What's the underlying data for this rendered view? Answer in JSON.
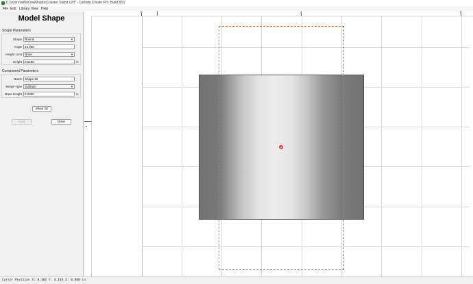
{
  "window": {
    "title": "C:\\Users\\wilfa\\Downloads\\Coaster Stand.c2d* - Carbide Create Pro: Build 653"
  },
  "menu": [
    "File",
    "Edit",
    "Library",
    "View",
    "Help"
  ],
  "panel": {
    "title": "Model Shape",
    "shape_parameters": {
      "header": "Shape Parameters",
      "shape_label": "Shape",
      "shape_value": "Round",
      "angle_label": "Angle",
      "angle_value": "45.000",
      "height_limit_label": "Height Limit",
      "height_limit_value": "None",
      "height_label": "Height",
      "height_value": "0.6250",
      "height_unit": "in"
    },
    "component_parameters": {
      "header": "Component Parameters",
      "name_label": "Name",
      "name_value": "Shape 10",
      "merge_type_label": "Merge Type",
      "merge_type_value": "Subtract",
      "base_height_label": "Base Height",
      "base_height_value": "0.0000",
      "base_height_unit": "in"
    },
    "buttons": {
      "show3d": "Show 3D",
      "apply": "Apply",
      "done": "Done"
    }
  },
  "ruler": {
    "labels": [
      "0",
      "4",
      "8"
    ]
  },
  "status": {
    "cursor": "Cursor Position X: 0.383 Y: 4.146 Z: 0.000 in"
  },
  "colors": {
    "selection": "#f06a2a",
    "origin": "#e53935",
    "accent_marker": "#e53935"
  },
  "icons": {
    "origin": "origin-marker-icon",
    "app": "carbide-app-icon"
  }
}
